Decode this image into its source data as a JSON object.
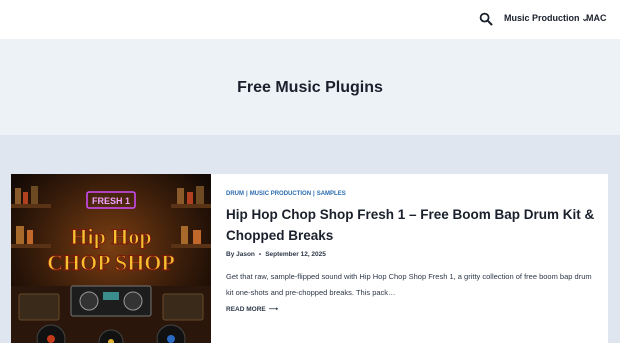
{
  "header": {
    "nav": [
      {
        "label": "Music Production",
        "has_dropdown": true
      },
      {
        "label": "MAC"
      }
    ],
    "search_icon": "search-icon"
  },
  "hero": {
    "title": "Free Music Plugins"
  },
  "post": {
    "categories": [
      "DRUM",
      "MUSIC PRODUCTION",
      "SAMPLES"
    ],
    "title": "Hip Hop Chop Shop Fresh 1 – Free Boom Bap Drum Kit & Chopped Breaks",
    "author": "By Jason",
    "date": "September 12, 2025",
    "excerpt": "Get that raw, sample-flipped sound with Hip Hop Chop Shop Fresh 1, a gritty collection of free boom bap drum kit one-shots and pre-chopped breaks. This pack…",
    "read_more": "READ MORE",
    "thumbnail": {
      "sign_text": "FRESH 1",
      "logo_line1": "Hip Hop",
      "logo_line2": "CHOP SHOP"
    }
  },
  "colors": {
    "accent": "#2b6cb0",
    "hero_bg": "#edf2f7",
    "page_bg": "#dfe6ef",
    "text": "#1a202c"
  }
}
